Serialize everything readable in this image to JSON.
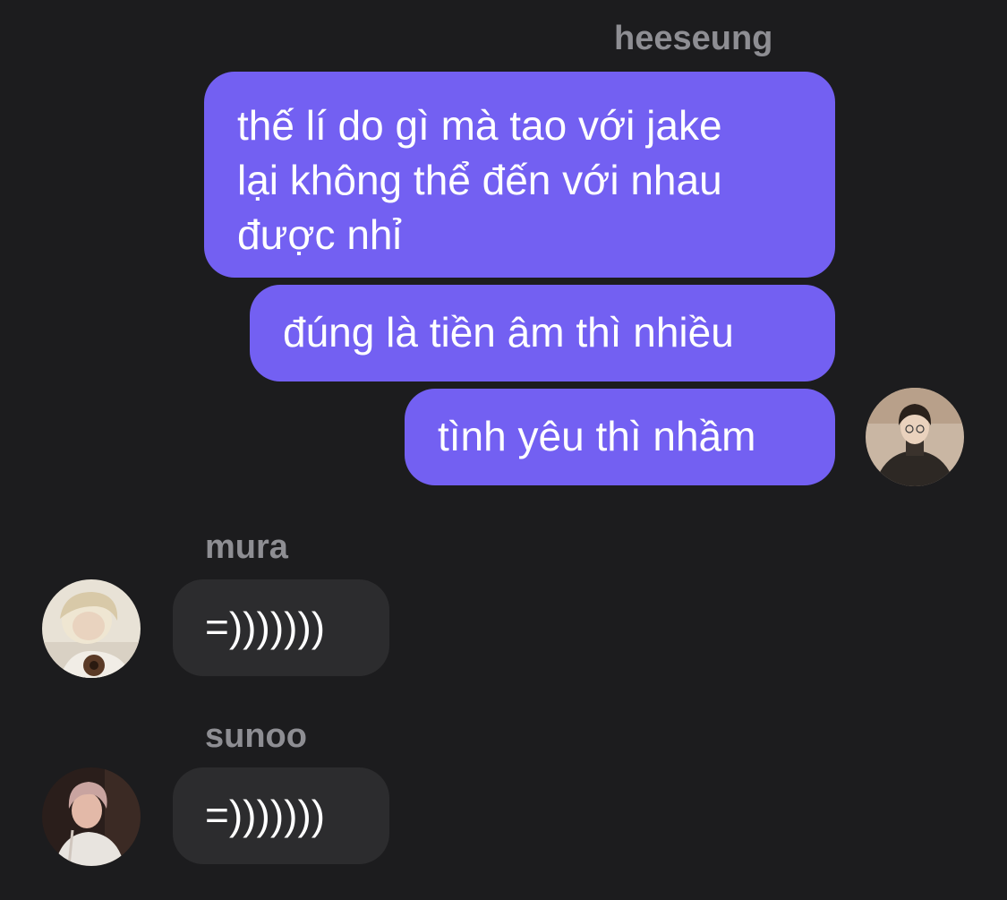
{
  "messages": {
    "outgoing": {
      "sender": "heeseung",
      "bubbles": [
        {
          "lines": [
            "thế lí do gì mà tao với jake",
            "lại không thể đến với nhau",
            "được nhỉ"
          ]
        },
        {
          "lines": [
            "đúng là tiền âm thì nhiều"
          ]
        },
        {
          "lines": [
            "tình yêu thì nhầm"
          ]
        }
      ]
    },
    "incoming": [
      {
        "sender": "mura",
        "text": "=)))))))"
      },
      {
        "sender": "sunoo",
        "text": "=)))))))"
      }
    ]
  },
  "colors": {
    "background": "#1c1c1e",
    "outgoing_bubble": "#7360f2",
    "incoming_bubble": "#2c2c2e",
    "sender_name": "#8e8e93",
    "message_text": "#ffffff"
  },
  "avatars": {
    "heeseung": "profile-photo-heeseung",
    "mura": "profile-photo-mura",
    "sunoo": "profile-photo-sunoo"
  }
}
